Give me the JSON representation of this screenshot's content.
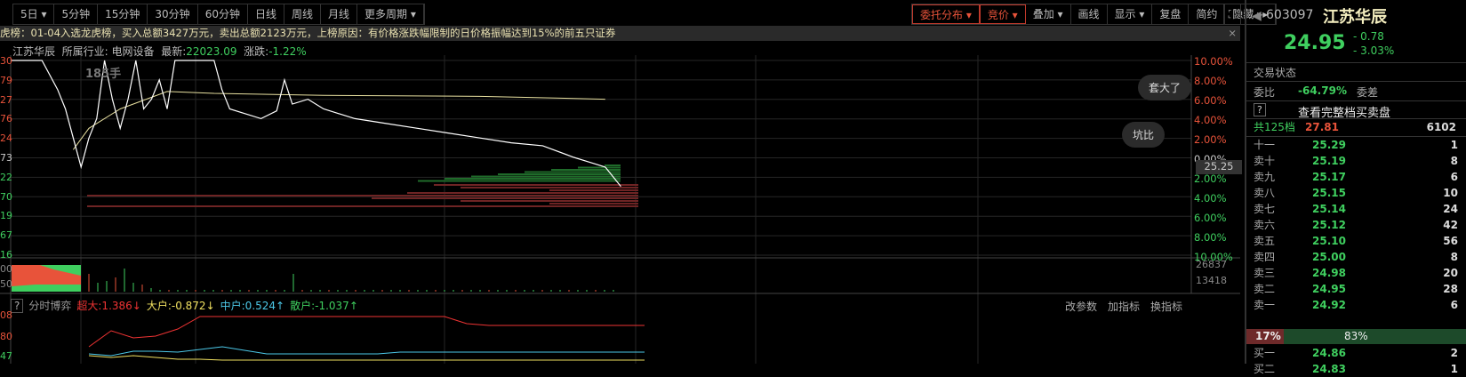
{
  "toolbar": {
    "periods": [
      "5日 ▾",
      "5分钟",
      "15分钟",
      "30分钟",
      "60分钟",
      "日线",
      "周线",
      "月线",
      "更多周期 ▾"
    ],
    "right": [
      "委托分布 ▾",
      "竞价 ▾",
      "叠加 ▾",
      "画线",
      "显示 ▾",
      "复盘",
      "简约",
      "隐藏 ▸▸"
    ],
    "fullscreen_icon": "⛶"
  },
  "infobar": {
    "text": "虎榜：01-04入选龙虎榜，买入总额3427万元，卖出总额2123万元，上榜原因：有价格涨跌幅限制的日价格振幅达到15%的前五只证券",
    "close": "×"
  },
  "chart_header": {
    "name": "江苏华辰",
    "industry_label": "所属行业:",
    "industry": "电网设备",
    "latest_label": "最新:",
    "latest": "22023.09",
    "change_label": "涨跌:",
    "change": "-1.22%"
  },
  "volume_note": "185手",
  "left_axis": [
    "30",
    "79",
    "27",
    "76",
    "24",
    "73",
    "22",
    "70",
    "19",
    "67",
    "16"
  ],
  "right_axis": [
    "10.00%",
    "8.00%",
    "6.00%",
    "4.00%",
    "2.00%",
    "0.00%",
    "2.00%",
    "4.00%",
    "6.00%",
    "8.00%",
    "10.00%"
  ],
  "price_tag": "25.25",
  "volume_axis": [
    "26837",
    "13418"
  ],
  "volume_left_axis": [
    "00",
    "50"
  ],
  "bubbles": [
    "套大了",
    "坑比"
  ],
  "price_series": [
    [
      0,
      10
    ],
    [
      4,
      10
    ],
    [
      6,
      7
    ],
    [
      7,
      5
    ],
    [
      8,
      2
    ],
    [
      9,
      -1
    ],
    [
      10,
      2
    ],
    [
      11,
      4
    ],
    [
      12,
      10
    ],
    [
      13,
      6
    ],
    [
      14,
      3
    ],
    [
      15,
      6
    ],
    [
      16,
      10
    ],
    [
      17,
      5
    ],
    [
      18,
      6
    ],
    [
      19,
      8
    ],
    [
      20,
      5
    ],
    [
      21,
      10
    ],
    [
      24,
      10
    ],
    [
      26,
      10
    ],
    [
      27,
      7
    ],
    [
      28,
      5
    ],
    [
      30,
      4.5
    ],
    [
      32,
      4
    ],
    [
      34,
      4.8
    ],
    [
      35,
      8
    ],
    [
      36,
      5.5
    ],
    [
      38,
      6
    ],
    [
      40,
      5
    ],
    [
      44,
      4
    ],
    [
      48,
      3.5
    ],
    [
      52,
      3
    ],
    [
      56,
      2.5
    ],
    [
      60,
      2
    ],
    [
      64,
      1.5
    ],
    [
      68,
      1.2
    ],
    [
      72,
      0
    ],
    [
      74,
      -0.5
    ],
    [
      76,
      -1
    ],
    [
      77,
      -2
    ],
    [
      78,
      -3
    ]
  ],
  "avg_series": [
    [
      8,
      0.8
    ],
    [
      10,
      3
    ],
    [
      14,
      5
    ],
    [
      20,
      6.8
    ],
    [
      26,
      6.6
    ],
    [
      40,
      6.4
    ],
    [
      60,
      6.3
    ],
    [
      76,
      6.0
    ]
  ],
  "indicator": {
    "help": "?",
    "title": "分时博弈",
    "super": "超大:1.386↓",
    "large": "大户:-0.872↓",
    "mid": "中户:0.524↑",
    "retail": "散户:-1.037↑",
    "left_axis": [
      "08",
      "80",
      "47"
    ],
    "tools": [
      "改参数",
      "加指标",
      "换指标"
    ]
  },
  "quote": {
    "code": "603097",
    "name": "江苏华辰",
    "price": "24.95",
    "change": "- 0.78",
    "pct": "- 3.03%",
    "status_label": "交易状态",
    "ratio_label": "委比",
    "ratio": "-64.79%",
    "diff_label": "委差",
    "full_book": "查看完整档买卖盘",
    "help": "?",
    "total_label": "共125档",
    "total_price": "27.81",
    "total_vol": "6102",
    "asks": [
      [
        "十一",
        "25.29",
        "1"
      ],
      [
        "卖十",
        "25.19",
        "8"
      ],
      [
        "卖九",
        "25.17",
        "6"
      ],
      [
        "卖八",
        "25.15",
        "10"
      ],
      [
        "卖七",
        "25.14",
        "24"
      ],
      [
        "卖六",
        "25.12",
        "42"
      ],
      [
        "卖五",
        "25.10",
        "56"
      ],
      [
        "卖四",
        "25.00",
        "8"
      ],
      [
        "卖三",
        "24.98",
        "20"
      ],
      [
        "卖二",
        "24.95",
        "28"
      ],
      [
        "卖一",
        "24.92",
        "6"
      ]
    ],
    "sell_pct": "17%",
    "buy_pct": "83%",
    "sell_fraction": 0.17,
    "bids": [
      [
        "买一",
        "24.86",
        "2"
      ],
      [
        "买二",
        "24.83",
        "1"
      ]
    ]
  },
  "colors": {
    "up": "#e8533a",
    "down": "#3fcf5f",
    "bg": "#000000"
  }
}
